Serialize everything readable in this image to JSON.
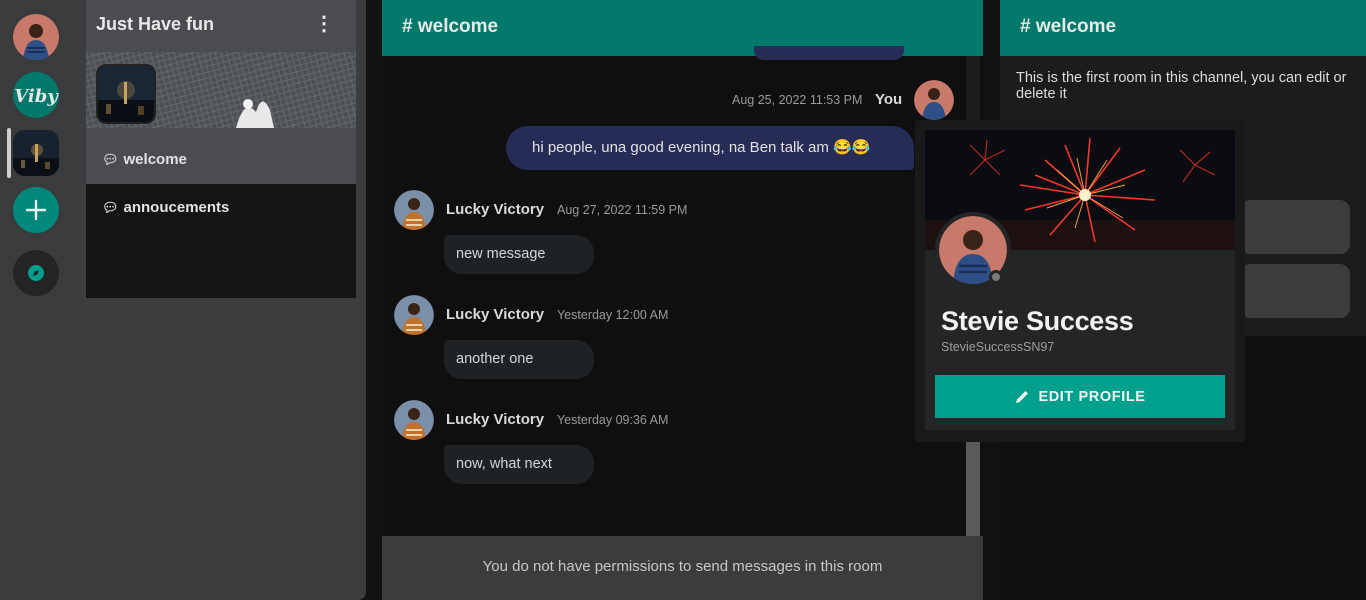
{
  "servers": {
    "profile_avatar": "user-avatar",
    "viby_logo": "Viby",
    "active_server": "city-night-thumbnail",
    "add_server_icon": "plus-icon",
    "explore_icon": "compass-icon"
  },
  "sidebar": {
    "server_name": "Just Have fun",
    "menu_icon": "⋮",
    "channels": [
      {
        "label": "welcome",
        "icon": "chat-bubble-icon"
      },
      {
        "label": "annoucements",
        "icon": "chat-bubble-icon"
      }
    ]
  },
  "chat": {
    "channel_title": "# welcome",
    "messages": [
      {
        "author": "You",
        "timestamp": "Aug 25, 2022 11:53 PM",
        "text": "hi people, una good evening, na Ben talk am 😂😂"
      },
      {
        "author": "Lucky Victory",
        "timestamp": "Aug 27, 2022 11:59 PM",
        "text": "new message"
      },
      {
        "author": "Lucky Victory",
        "timestamp": "Yesterday 12:00 AM",
        "text": "another one"
      },
      {
        "author": "Lucky Victory",
        "timestamp": "Yesterday 09:36 AM",
        "text": "now, what next"
      }
    ],
    "footer_notice": "You do not have permissions to send messages in this room"
  },
  "right_panel": {
    "channel_title": "# welcome",
    "description": "This is the first room in this channel, you can edit or delete it"
  },
  "profile_popup": {
    "display_name": "Stevie Success",
    "username": "StevieSuccessSN97",
    "edit_button": "EDIT PROFILE",
    "status": "offline"
  },
  "colors": {
    "accent": "#00796b",
    "button": "#00a08c",
    "outgoing_bubble": "#262c55",
    "incoming_bubble": "#1e2224"
  }
}
